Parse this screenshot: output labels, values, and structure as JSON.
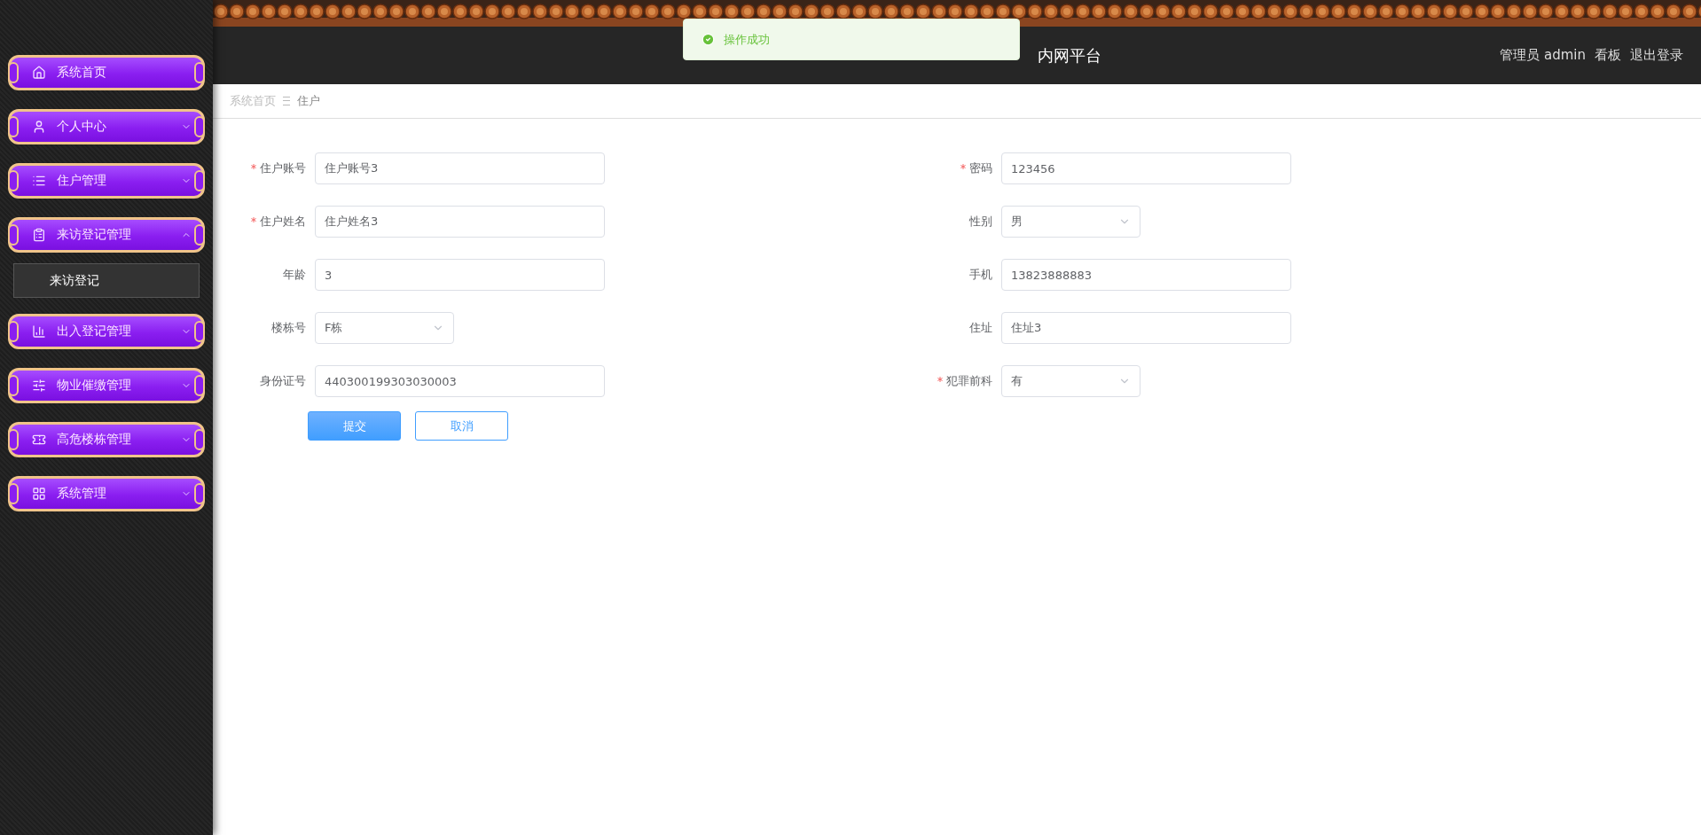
{
  "header": {
    "title": "内网平台",
    "user_links": [
      {
        "label": "管理员 admin"
      },
      {
        "label": "看板"
      },
      {
        "label": "退出登录"
      }
    ]
  },
  "toast": {
    "kind": "success",
    "message": "操作成功"
  },
  "breadcrumb": [
    "系统首页",
    "住户"
  ],
  "sidebar": {
    "items": [
      {
        "label": "系统首页"
      },
      {
        "label": "个人中心",
        "expanded": false
      },
      {
        "label": "住户管理",
        "expanded": false
      },
      {
        "label": "来访登记管理",
        "expanded": true,
        "children": [
          {
            "label": "来访登记"
          }
        ]
      },
      {
        "label": "出入登记管理",
        "expanded": false
      },
      {
        "label": "物业催缴管理",
        "expanded": false
      },
      {
        "label": "高危楼栋管理",
        "expanded": false
      },
      {
        "label": "系统管理",
        "expanded": false
      }
    ]
  },
  "form": {
    "fields": [
      {
        "label": "住户账号",
        "kind": "input",
        "required": true,
        "value": "住户账号3"
      },
      {
        "label": "密码",
        "kind": "input",
        "required": true,
        "value": "123456"
      },
      {
        "label": "住户姓名",
        "kind": "input",
        "required": true,
        "value": "住户姓名3"
      },
      {
        "label": "性别",
        "kind": "select",
        "required": false,
        "value": "男"
      },
      {
        "label": "年龄",
        "kind": "input",
        "required": false,
        "value": "3"
      },
      {
        "label": "手机",
        "kind": "input",
        "required": false,
        "value": "13823888883"
      },
      {
        "label": "楼栋号",
        "kind": "select",
        "required": false,
        "value": "F栋"
      },
      {
        "label": "住址",
        "kind": "input",
        "required": false,
        "value": "住址3"
      },
      {
        "label": "身份证号",
        "kind": "input",
        "required": false,
        "value": "440300199303030003"
      },
      {
        "label": "犯罪前科",
        "kind": "select",
        "required": true,
        "value": "有"
      }
    ],
    "buttons": [
      {
        "label": "提交",
        "kind": "primary"
      },
      {
        "label": "取消",
        "kind": "plain"
      }
    ]
  }
}
